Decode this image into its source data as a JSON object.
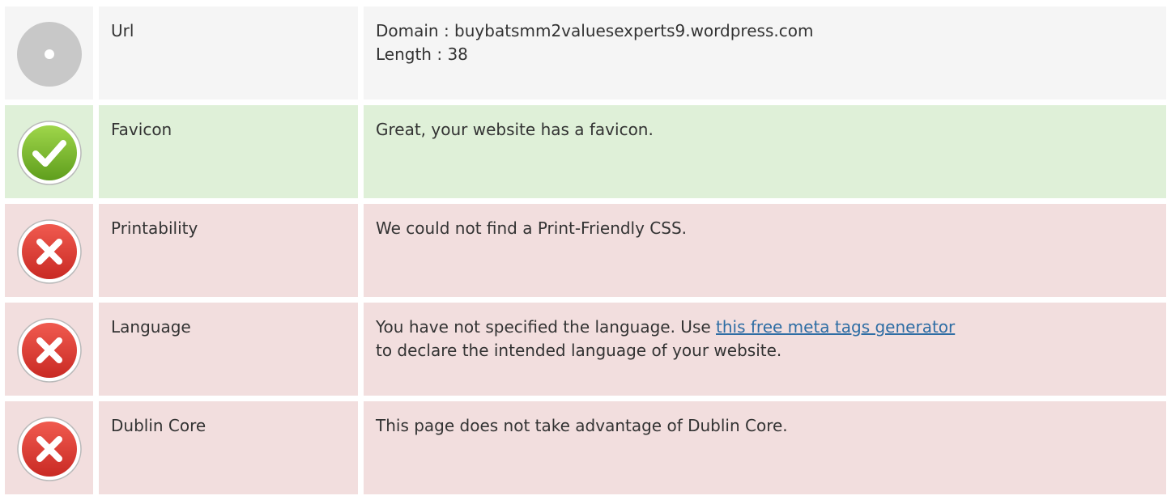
{
  "rows": [
    {
      "status": "neutral",
      "icon": "info-dot-icon",
      "label": "Url",
      "lines": [
        "Domain : buybatsmm2valuesexperts9.wordpress.com",
        "Length : 38"
      ]
    },
    {
      "status": "good",
      "icon": "check-circle-icon",
      "label": "Favicon",
      "text": "Great, your website has a favicon."
    },
    {
      "status": "bad",
      "icon": "error-circle-icon",
      "label": "Printability",
      "text": "We could not find a Print-Friendly CSS."
    },
    {
      "status": "bad",
      "icon": "error-circle-icon",
      "label": "Language",
      "text_before": "You have not specified the language. Use ",
      "link_text": "this free meta tags generator",
      "text_after": "to declare the intended language of your website."
    },
    {
      "status": "bad",
      "icon": "error-circle-icon",
      "label": "Dublin Core",
      "text": "This page does not take advantage of Dublin Core."
    }
  ],
  "colors": {
    "neutral_bg": "#f5f5f5",
    "good_bg": "#dff0d8",
    "bad_bg": "#f2dede",
    "link": "#2e6da4",
    "icon_neutral": "#c8c8c8",
    "icon_good": "#7dba2f",
    "icon_bad": "#e2403a"
  }
}
